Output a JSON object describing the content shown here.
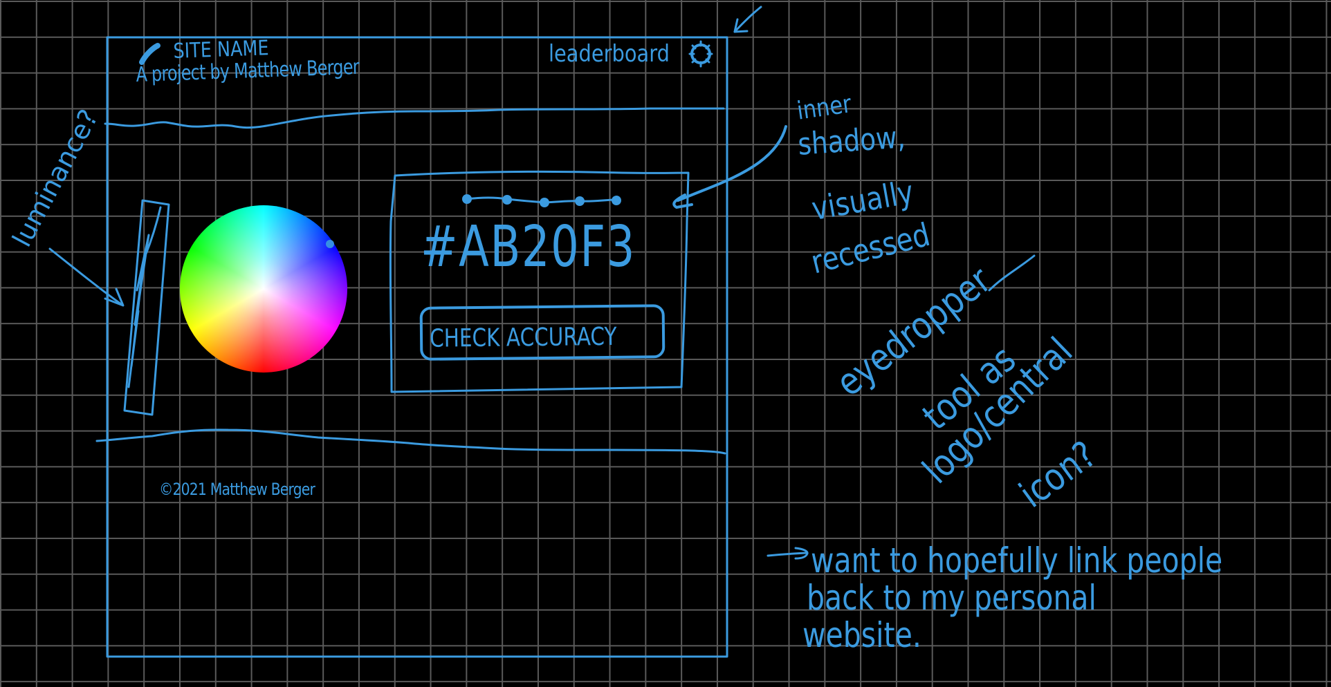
{
  "sketch": {
    "background_color": "#000000",
    "grid_color": "#5a5a5a",
    "ink_color": "#3b9be0"
  },
  "header": {
    "site_name": "SITE NAME",
    "tagline": "A project by Matthew Berger",
    "leaderboard_label": "leaderboard",
    "settings_icon": "gear-icon",
    "logo_icon": "eyedropper-icon"
  },
  "main": {
    "luminance_slider_icon": "luminance-slider",
    "color_wheel_icon": "color-wheel",
    "hex_code": "#AB20F3",
    "progress_dots_count": 5,
    "check_button_label": "CHECK ACCURACY"
  },
  "footer": {
    "copyright": "©2021 Matthew Berger"
  },
  "annotations": {
    "luminance": "luminance?",
    "inner_shadow_line1": "inner",
    "inner_shadow_line2": "shadow,",
    "recessed_line1": "visually",
    "recessed_line2": "recessed",
    "eyedropper_line1": "eyedropper",
    "eyedropper_line2": "tool as",
    "eyedropper_line3": "logo/central",
    "eyedropper_line4": "icon?",
    "website_line1": "want to hopefully link people",
    "website_line2": "back to my personal",
    "website_line3": "website."
  }
}
